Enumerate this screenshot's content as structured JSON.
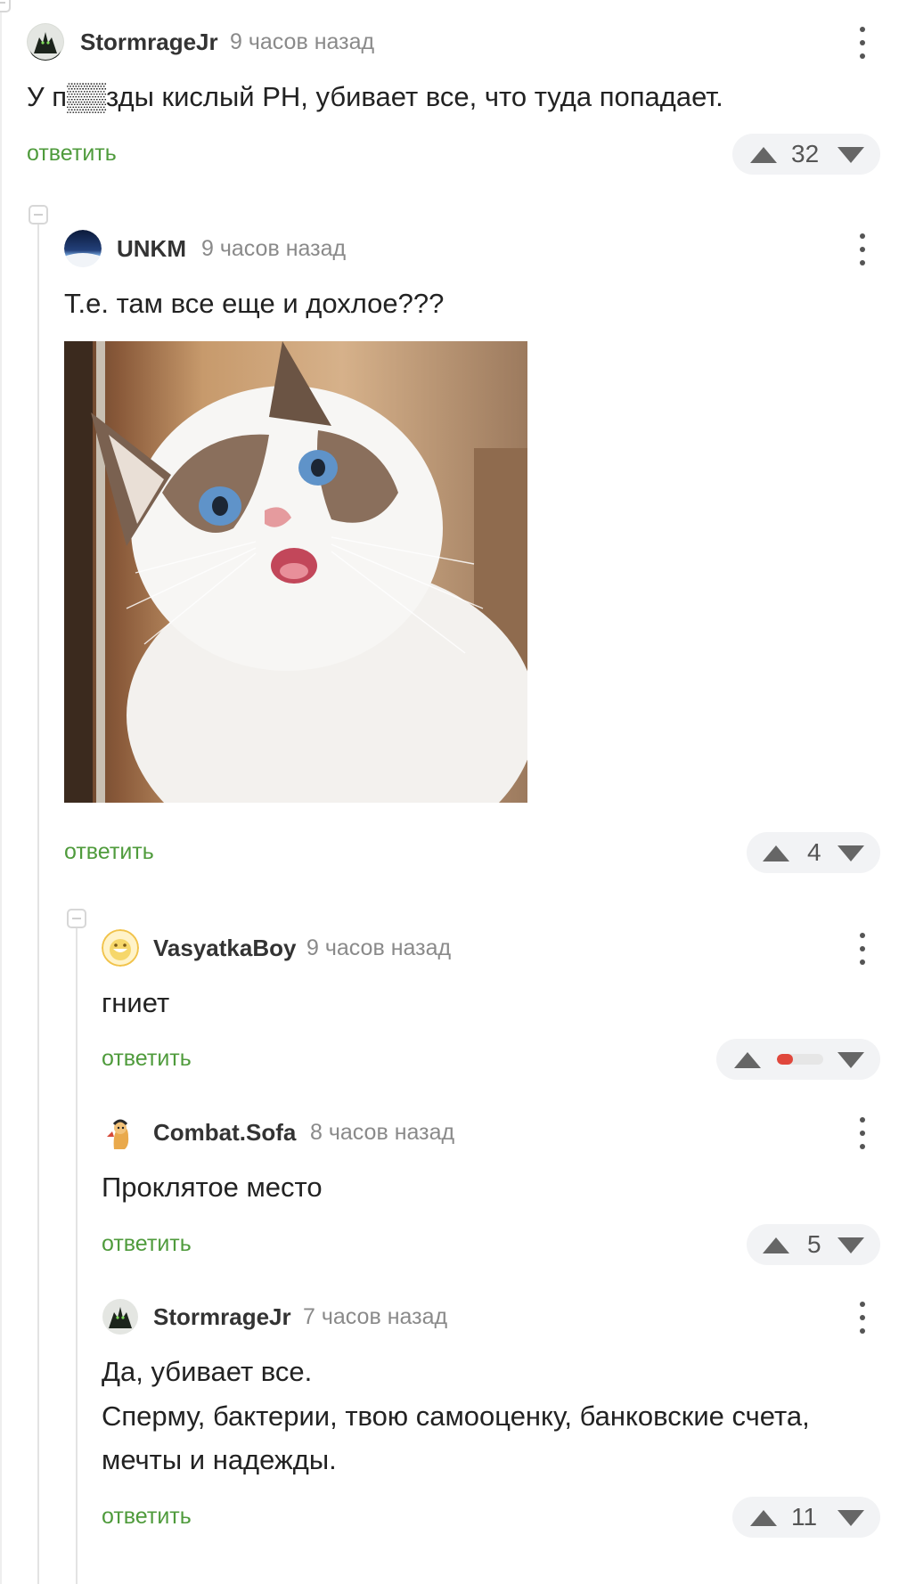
{
  "comments": [
    {
      "username": "StormrageJr",
      "time": "9 часов назад",
      "text": "У п▒▒зды кислый РН, убивает все, что туда попадает.",
      "reply_label": "ответить",
      "rating": "32",
      "avatar_icon": "dark-creature-avatar"
    },
    {
      "username": "UNKM",
      "time": "9 часов назад",
      "text": "Т.е. там все еще и дохлое???",
      "reply_label": "ответить",
      "rating": "4",
      "avatar_icon": "earth-horizon-avatar",
      "image_subject": "surprised-cat-photo"
    },
    {
      "username": "VasyatkaBoy",
      "time": "9 часов назад",
      "text": "гниет",
      "reply_label": "ответить",
      "rating_bar_negative_fraction": 0.35,
      "avatar_icon": "yellow-smiley-avatar"
    },
    {
      "username": "Combat.Sofa",
      "time": "8 часов назад",
      "text": "Проклятое место",
      "reply_label": "ответить",
      "rating": "5",
      "avatar_icon": "cartoon-character-avatar"
    },
    {
      "username": "StormrageJr",
      "time": "7 часов назад",
      "text_lines": [
        "Да, убивает все.",
        "Сперму, бактерии, твою самооценку, банковские счета,",
        "мечты и надежды."
      ],
      "reply_label": "ответить",
      "rating": "11",
      "avatar_icon": "dark-creature-avatar"
    }
  ],
  "colors": {
    "reply_link": "#4f9b3c",
    "vote_bg": "#f2f3f5",
    "thread_line": "#e3e3e3",
    "negative_rating": "#e0473c"
  }
}
